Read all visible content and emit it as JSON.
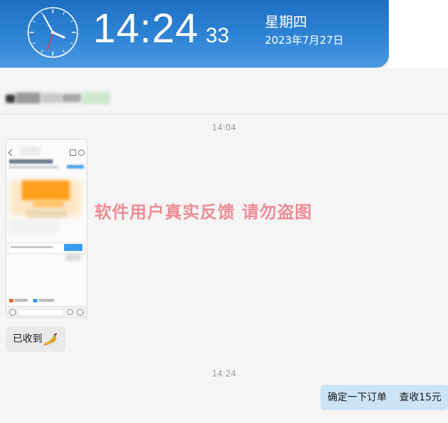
{
  "clock": {
    "time": "14:24",
    "seconds": "33",
    "weekday": "星期四",
    "date": "2023年7月27日",
    "icon": "analog-clock-icon"
  },
  "chat": {
    "messages": [
      {
        "type": "timestamp",
        "text": "14:04"
      },
      {
        "type": "image",
        "direction": "received",
        "content": "blurred-phone-screenshot"
      },
      {
        "type": "text",
        "direction": "received",
        "text": "已收到",
        "emoji": "banana-emoji"
      },
      {
        "type": "timestamp",
        "text": "14:24"
      },
      {
        "type": "text",
        "direction": "sent",
        "text": "确定一下订单    查收15元"
      }
    ]
  },
  "watermark": {
    "text": "软件用户真实反馈  请勿盗图"
  },
  "colors": {
    "clock_bg": "#2f84d6",
    "received_bubble": "#e9e9e9",
    "sent_bubble": "#cce4f7",
    "watermark": "#eb6e78"
  }
}
